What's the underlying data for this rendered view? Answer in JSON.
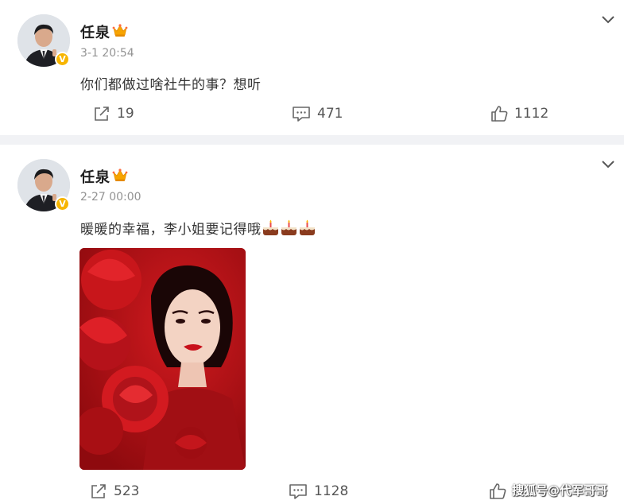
{
  "posts": [
    {
      "username": "任泉",
      "time": "3-1 20:54",
      "text": "你们都做过啥社牛的事？想听",
      "reposts": "19",
      "comments": "471",
      "likes": "1112"
    },
    {
      "username": "任泉",
      "time": "2-27 00:00",
      "text": "暖暖的幸福，李小姐要记得哦",
      "emoji": [
        "cake-emoji",
        "cake-emoji",
        "cake-emoji"
      ],
      "reposts": "523",
      "comments": "1128",
      "likes": ""
    }
  ],
  "verified_badge": "V",
  "watermark": "搜狐号@代军哥哥",
  "colors": {
    "accent": "#f7b500",
    "text": "#333333",
    "meta": "#939393",
    "separator": "#f1f2f5",
    "photo_red": "#c8161b"
  },
  "icons": {
    "repost": "repost-icon",
    "comment": "comment-icon",
    "like": "like-icon",
    "more": "chevron-down-icon",
    "crown": "crown-icon"
  }
}
